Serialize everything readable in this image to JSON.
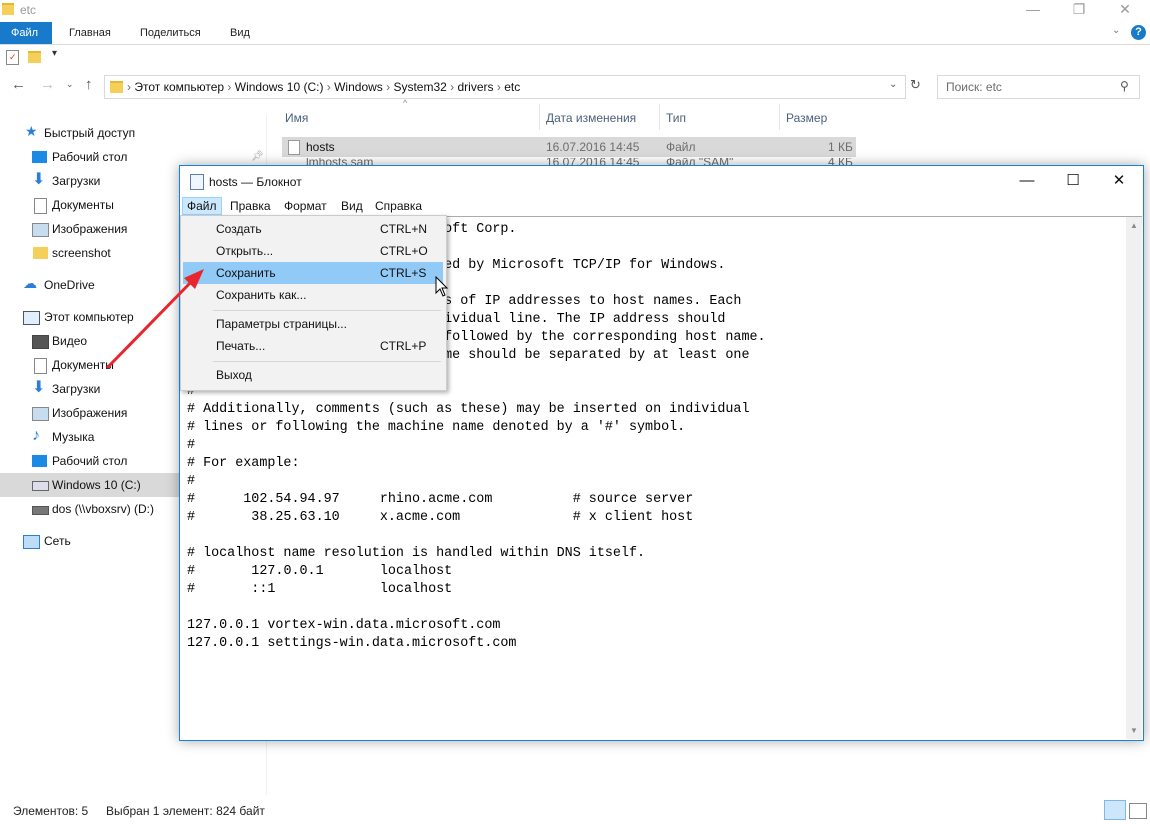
{
  "explorer": {
    "title": "etc",
    "ribbon_tabs": [
      "Файл",
      "Главная",
      "Поделиться",
      "Вид"
    ],
    "breadcrumbs": [
      "Этот компьютер",
      "Windows 10 (C:)",
      "Windows",
      "System32",
      "drivers",
      "etc"
    ],
    "search_placeholder": "Поиск: etc",
    "columns": [
      "Имя",
      "Дата изменения",
      "Тип",
      "Размер"
    ],
    "files": [
      {
        "name": "hosts",
        "date": "16.07.2016 14:45",
        "type": "Файл",
        "size": "1 КБ"
      },
      {
        "name": "lmhosts.sam",
        "date": "16.07.2016 14:45",
        "type": "Файл \"SAM\"",
        "size": "4 КБ"
      }
    ],
    "nav_items": [
      "Быстрый доступ",
      "Рабочий стол",
      "Загрузки",
      "Документы",
      "Изображения",
      "screenshot",
      "OneDrive",
      "Этот компьютер",
      "Видео",
      "Документы",
      "Загрузки",
      "Изображения",
      "Музыка",
      "Рабочий стол",
      "Windows 10 (C:)",
      "dos (\\\\vboxsrv) (D:)",
      "Сеть"
    ],
    "status_count": "Элементов: 5",
    "status_selected": "Выбран 1 элемент: 824 байт"
  },
  "notepad": {
    "title": "hosts — Блокнот",
    "menu": [
      "Файл",
      "Правка",
      "Формат",
      "Вид",
      "Справка"
    ],
    "file_menu": [
      {
        "label": "Создать",
        "shortcut": "CTRL+N"
      },
      {
        "label": "Открыть...",
        "shortcut": "CTRL+O"
      },
      {
        "label": "Сохранить",
        "shortcut": "CTRL+S"
      },
      {
        "label": "Сохранить как...",
        "shortcut": ""
      },
      {
        "label": "Параметры страницы...",
        "shortcut": ""
      },
      {
        "label": "Печать...",
        "shortcut": "CTRL+P"
      },
      {
        "label": "Выход",
        "shortcut": ""
      }
    ],
    "content": "# Copyright (c) 1993-2009 Microsoft Corp.\n#\n# This is a sample HOSTS file used by Microsoft TCP/IP for Windows.\n#\n# This file contains the mappings of IP addresses to host names. Each\n# entry should be kept on an individual line. The IP address should\n# be placed in the first column followed by the corresponding host name.\n# The IP address and the host name should be separated by at least one\n# space.\n#\n# Additionally, comments (such as these) may be inserted on individual\n# lines or following the machine name denoted by a '#' symbol.\n#\n# For example:\n#\n#      102.54.94.97     rhino.acme.com          # source server\n#       38.25.63.10     x.acme.com              # x client host\n\n# localhost name resolution is handled within DNS itself.\n#\t127.0.0.1       localhost\n#\t::1             localhost\n\n127.0.0.1 vortex-win.data.microsoft.com\n127.0.0.1 settings-win.data.microsoft.com"
  },
  "colors": {
    "accent": "#1979ca",
    "menu_highlight": "#91c9f7",
    "arrow": "#e8262d"
  }
}
